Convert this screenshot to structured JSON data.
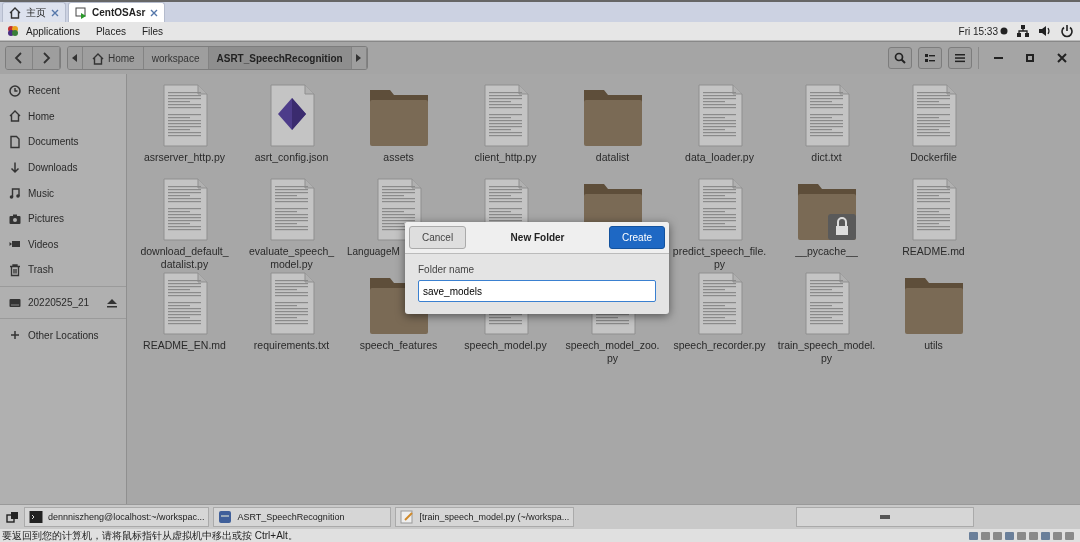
{
  "vm_tabs": [
    {
      "label": "主页",
      "kind": "home",
      "selected": false
    },
    {
      "label": "CentOSAsr",
      "kind": "vm",
      "selected": true
    }
  ],
  "top_bar": {
    "menus": [
      "Applications",
      "Places",
      "Files"
    ],
    "clock": "Fri 15:33"
  },
  "header": {
    "path": [
      {
        "label": "Home",
        "kind": "home",
        "selected": false
      },
      {
        "label": "workspace",
        "kind": "plain",
        "selected": false
      },
      {
        "label": "ASRT_SpeechRecognition",
        "kind": "plain",
        "selected": true
      }
    ]
  },
  "sidebar": {
    "sections": [
      {
        "items": [
          {
            "label": "Recent",
            "kind": "recent"
          },
          {
            "label": "Home",
            "kind": "home"
          },
          {
            "label": "Documents",
            "kind": "documents"
          },
          {
            "label": "Downloads",
            "kind": "downloads"
          },
          {
            "label": "Music",
            "kind": "music"
          },
          {
            "label": "Pictures",
            "kind": "pictures"
          },
          {
            "label": "Videos",
            "kind": "videos"
          },
          {
            "label": "Trash",
            "kind": "trash"
          }
        ]
      },
      {
        "items": [
          {
            "label": "20220525_21",
            "kind": "drive"
          }
        ]
      },
      {
        "items": [
          {
            "label": "Other Locations",
            "kind": "other"
          }
        ]
      }
    ]
  },
  "files": [
    {
      "label": "asrserver_http.py",
      "kind": "doc"
    },
    {
      "label": "asrt_config.json",
      "kind": "json"
    },
    {
      "label": "assets",
      "kind": "folder"
    },
    {
      "label": "client_http.py",
      "kind": "doc"
    },
    {
      "label": "datalist",
      "kind": "folder"
    },
    {
      "label": "data_loader.py",
      "kind": "doc"
    },
    {
      "label": "dict.txt",
      "kind": "doc"
    },
    {
      "label": "Dockerfile",
      "kind": "doc"
    },
    {
      "label": "download_default_datalist.py",
      "kind": "doc"
    },
    {
      "label": "evaluate_speech_model.py",
      "kind": "doc"
    },
    {
      "label": "LanguageM",
      "kind": "doc",
      "clipped": true
    },
    {
      "kind": "doc"
    },
    {
      "kind": "folder"
    },
    {
      "label": "predict_speech_file.py",
      "kind": "doc"
    },
    {
      "label": "__pycache__",
      "kind": "folder_locked"
    },
    {
      "label": "README.md",
      "kind": "doc"
    },
    {
      "label": "README_EN.md",
      "kind": "doc"
    },
    {
      "label": "requirements.txt",
      "kind": "doc"
    },
    {
      "label": "speech_features",
      "kind": "folder"
    },
    {
      "label": "speech_model.py",
      "kind": "doc"
    },
    {
      "label": "speech_model_zoo.py",
      "kind": "doc"
    },
    {
      "label": "speech_recorder.py",
      "kind": "doc"
    },
    {
      "label": "train_speech_model.py",
      "kind": "doc"
    },
    {
      "label": "utils",
      "kind": "folder"
    }
  ],
  "dialog": {
    "cancel": "Cancel",
    "title": "New Folder",
    "create": "Create",
    "field_label": "Folder name",
    "value": "save_models"
  },
  "taskbar": {
    "tasks": [
      {
        "label": "dennniszheng@localhost:~/workspac...",
        "kind": "terminal"
      },
      {
        "label": "ASRT_SpeechRecognition",
        "kind": "files"
      },
      {
        "label": "[train_speech_model.py (~/workspa...",
        "kind": "editor"
      }
    ]
  },
  "status_text": "要返回到您的计算机，请将鼠标指针从虚拟机中移出或按 Ctrl+Alt。"
}
